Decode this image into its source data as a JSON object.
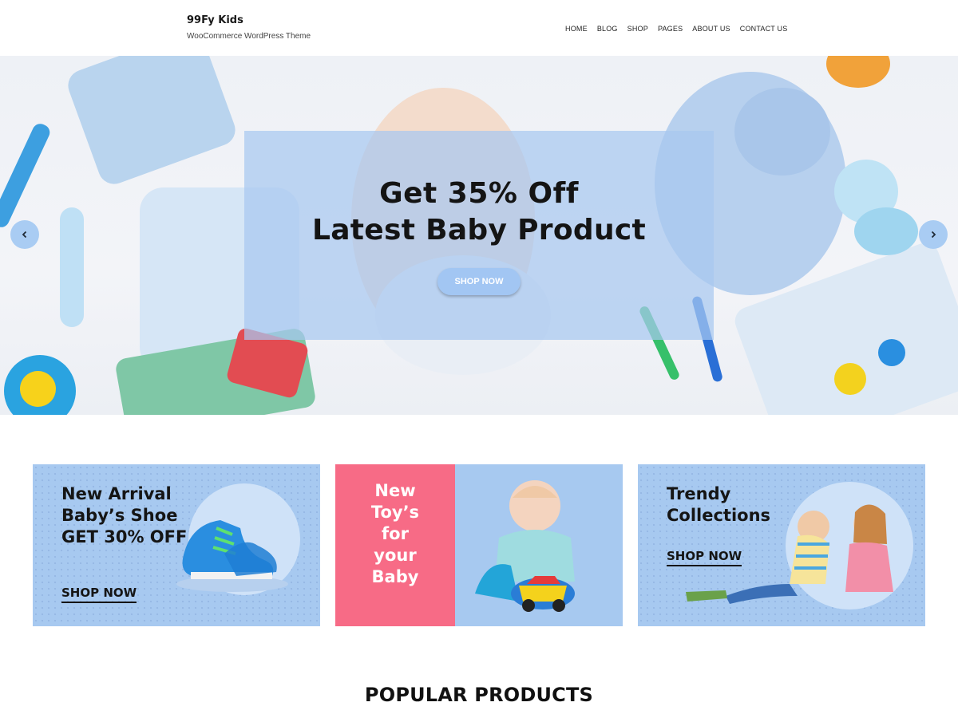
{
  "header": {
    "site_title": "99Fy Kids",
    "tagline": "WooCommerce WordPress Theme",
    "nav": [
      "HOME",
      "BLOG",
      "SHOP",
      "PAGES",
      "ABOUT US",
      "CONTACT US"
    ]
  },
  "hero": {
    "line1": "Get 35% Off",
    "line2": "Latest Baby Product",
    "button": "SHOP NOW",
    "prev_icon": "chevron-left-icon",
    "next_icon": "chevron-right-icon"
  },
  "banners": [
    {
      "title_lines": [
        "New Arrival",
        "Baby’s Shoe",
        "GET 30% OFF"
      ],
      "link": "SHOP NOW"
    },
    {
      "title_lines": [
        "New",
        "Toy’s",
        "for",
        "your",
        "Baby"
      ]
    },
    {
      "title_lines": [
        "Trendy",
        "Collections"
      ],
      "link": "SHOP NOW"
    }
  ],
  "section": {
    "title": "POPULAR PRODUCTS",
    "subtitle": ""
  },
  "colors": {
    "accent_blue": "#a7c9f0",
    "accent_pink": "#f76b86",
    "text_dark": "#151515"
  }
}
